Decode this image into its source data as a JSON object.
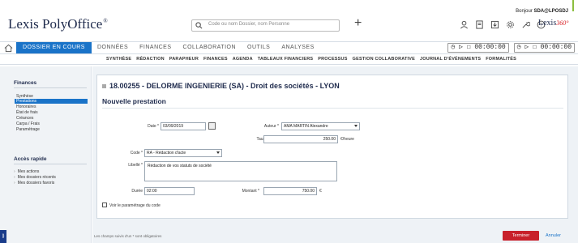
{
  "header": {
    "logo": "Lexis PolyOffice",
    "logo_mark": "®",
    "search_placeholder": "Code ou nom Dossier, nom Personne",
    "plus": "+",
    "user_greeting": "Bonjour",
    "user_name": "SDA@LPOSDJ",
    "lexis_brand": "Lexis",
    "lexis_suffix": "360°"
  },
  "nav": {
    "active_tab": "DOSSIER EN COURS",
    "tabs": [
      "DONNÉES",
      "FINANCES",
      "COLLABORATION",
      "OUTILS",
      "ANALYSES"
    ],
    "timers": [
      "00:00:00",
      "00:00:00"
    ]
  },
  "subnav": [
    "SYNTHÈSE",
    "RÉDACTION",
    "PARAPHEUR",
    "FINANCES",
    "AGENDA",
    "TABLEAUX FINANCIERS",
    "PROCESSUS",
    "GESTION COLLABORATIVE",
    "JOURNAL D'ÉVÉNEMENTS",
    "FORMALITÉS"
  ],
  "sidebar": {
    "finances_title": "Finances",
    "finances_items": [
      "Synthèse",
      "Prestations",
      "Honoraires",
      "État de frais",
      "Créances",
      "Carpa / Frais",
      "Paramétrage"
    ],
    "active_index": 1,
    "quick_title": "Accès rapide",
    "quick_items": [
      "Mes actions",
      "Mes dossiers récents",
      "Mes dossiers favoris"
    ]
  },
  "form": {
    "dossier_title": "18.00255 - DELORME INGENIERIE (SA) - Droit des sociétés - LYON",
    "section_title": "Nouvelle prestation",
    "date_label": "Date *",
    "date_value": "03/09/2019",
    "auteur_label": "Auteur *",
    "auteur_value": "AMA MARTIN Alexandre",
    "taux_label": "Taux horaire",
    "taux_value": "250.00",
    "taux_unit": "€/heure",
    "code_label": "Code *",
    "code_value": "RA - Rédaction d'acte",
    "libelle_label": "Libellé *",
    "libelle_value": "Rédaction de vos statuts de société",
    "duree_label": "Durée",
    "duree_value": "02:00",
    "montant_label": "Montant *",
    "montant_value": "750.00",
    "montant_unit": "€",
    "checkbox_label": "Voir le paramétrage du code"
  },
  "footer": {
    "required_note": "Les champs suivis d'un * sont obligatoires",
    "finish_button": "Terminer",
    "cancel_button": "Annuler"
  }
}
